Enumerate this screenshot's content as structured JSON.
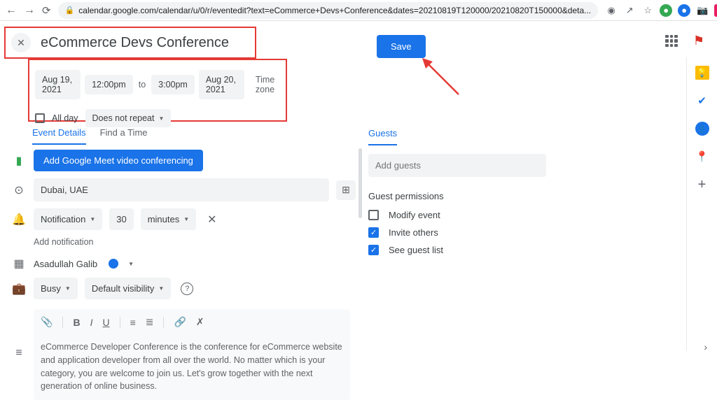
{
  "browser": {
    "url": "calendar.google.com/calendar/u/0/r/eventedit?text=eCommerce+Devs+Conference&dates=20210819T120000/20210820T150000&deta..."
  },
  "event": {
    "title": "eCommerce Devs Conference",
    "save_label": "Save"
  },
  "datetime": {
    "start_date": "Aug 19, 2021",
    "start_time": "12:00pm",
    "to": "to",
    "end_time": "3:00pm",
    "end_date": "Aug 20, 2021",
    "timezone_label": "Time zone",
    "all_day_label": "All day",
    "repeat_label": "Does not repeat"
  },
  "tabs": {
    "details": "Event Details",
    "findtime": "Find a Time"
  },
  "form": {
    "meet_label": "Add Google Meet video conferencing",
    "location": "Dubai, UAE",
    "notification_label": "Notification",
    "notification_value": "30",
    "notification_unit": "minutes",
    "add_notification": "Add notification",
    "calendar_owner": "Asadullah Galib",
    "busy_label": "Busy",
    "visibility_label": "Default visibility",
    "description": "eCommerce Developer Conference is the conference for eCommerce website and application developer from all over the world. No matter which is your category, you are welcome to join us. Let's grow together with the next generation of online business."
  },
  "guests": {
    "title": "Guests",
    "placeholder": "Add guests",
    "permissions_label": "Guest permissions",
    "modify": "Modify event",
    "invite": "Invite others",
    "seelist": "See guest list"
  }
}
